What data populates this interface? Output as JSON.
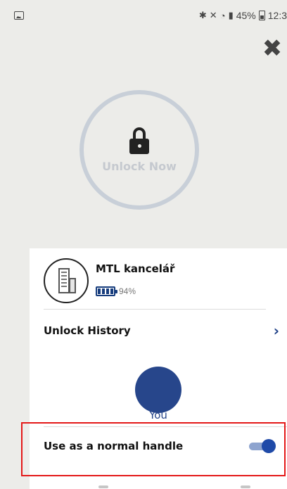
{
  "status_bar": {
    "battery_percent": "45%",
    "time": "12:3",
    "icons": [
      "gallery-icon",
      "bluetooth-icon",
      "mute-icon",
      "wifi-icon",
      "signal-icon",
      "battery-icon"
    ]
  },
  "close": {
    "icon": "close-icon",
    "glyph": "✖"
  },
  "unlock": {
    "label": "Unlock Now",
    "icon": "lock-icon"
  },
  "device": {
    "name": "MTL kancelář",
    "battery_label": "94%",
    "battery_level": 0.94,
    "icon": "building-icon"
  },
  "history": {
    "title": "Unlock History",
    "chevron": "›"
  },
  "users": [
    {
      "label": "You",
      "color": "#27468b"
    }
  ],
  "handle_option": {
    "label": "Use as a normal handle",
    "enabled": true
  },
  "colors": {
    "accent": "#1f4aa8",
    "avatar": "#27468b",
    "ring": "#c8cfd8",
    "highlight": "#e41818"
  }
}
